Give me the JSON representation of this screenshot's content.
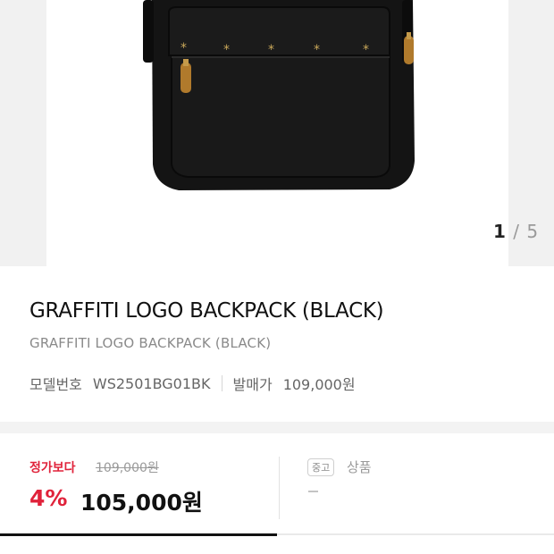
{
  "gallery": {
    "current": "1",
    "separator": "/",
    "total": "5",
    "image_icon": "backpack-photo"
  },
  "product": {
    "title": "GRAFFITI LOGO BACKPACK (BLACK)",
    "subtitle": "GRAFFITI LOGO BACKPACK (BLACK)",
    "model_label": "모델번호",
    "model_value": "WS2501BG01BK",
    "release_label": "발매가",
    "release_value": "109,000원"
  },
  "price": {
    "regular_label": "정가보다",
    "regular_price": "109,000원",
    "discount": "4%",
    "sale_price": "105,000원",
    "used_badge": "중고",
    "used_label": "상품",
    "used_value": "-"
  },
  "tabs": {
    "active_fraction": 0.5
  }
}
